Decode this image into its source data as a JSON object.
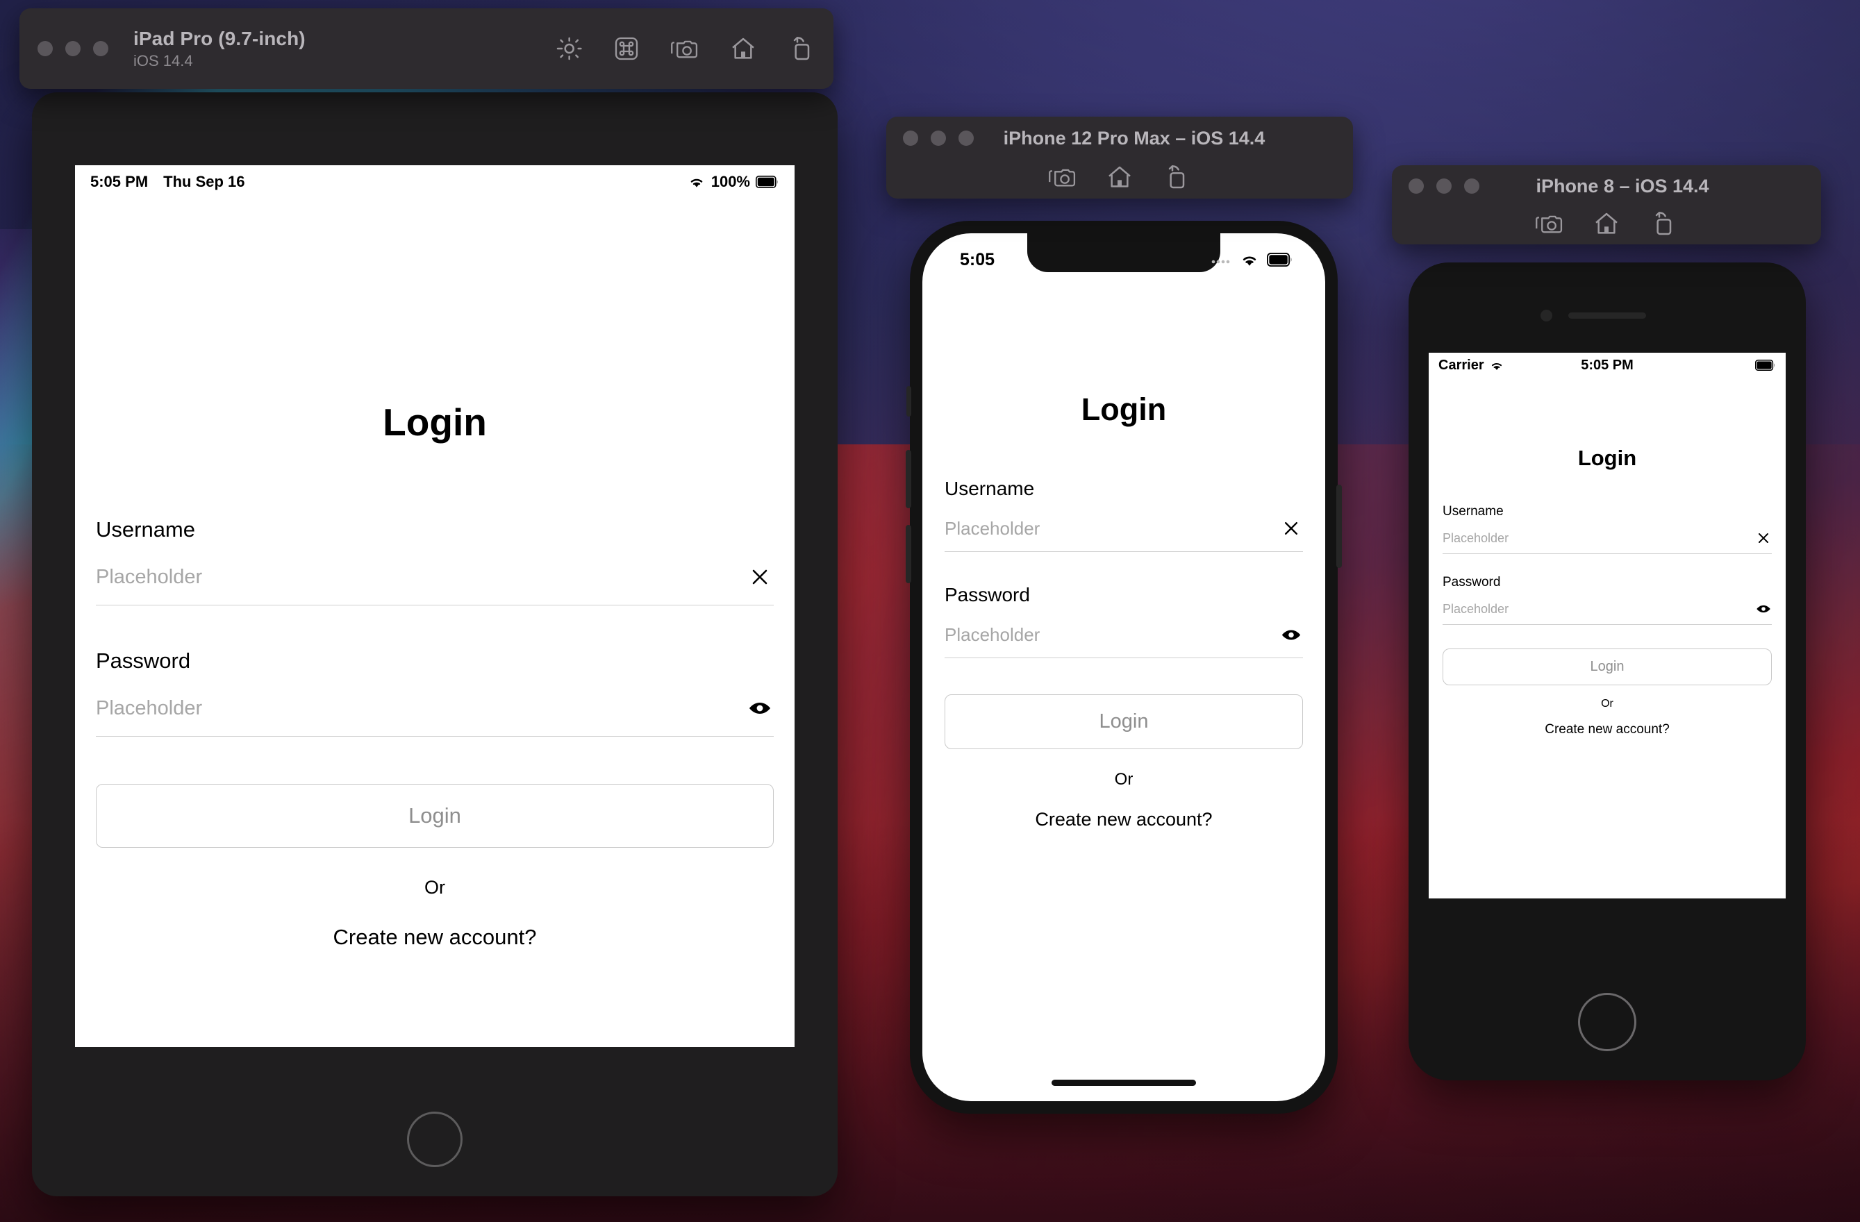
{
  "desktop": {
    "wallpaper_name": "macos-big-sur-gradient",
    "colors": {
      "indigo": "#2b2d5e",
      "wave_indigo": "#4c4892",
      "purple": "#6a42a8",
      "teal": "#40a6c4",
      "red": "#be2a2c",
      "dark_red": "#4e101c",
      "window_chrome": "#2e2b2f",
      "traffic_light": "#5a565b",
      "title_text": "#b9b6bb",
      "subtitle_text": "#8e8b90"
    }
  },
  "windows": [
    {
      "id": "ipad",
      "title": "iPad Pro (9.7-inch)",
      "subtitle": "iOS 14.4",
      "traffic_lights": [
        "close",
        "minimize",
        "zoom"
      ],
      "toolbar_icons": [
        "brightness-icon",
        "command-key-icon",
        "screenshot-camera-icon",
        "home-icon",
        "rotate-device-icon"
      ]
    },
    {
      "id": "iphone12",
      "title": "iPhone 12 Pro Max – iOS 14.4",
      "traffic_lights": [
        "close",
        "minimize",
        "zoom"
      ],
      "toolbar_icons": [
        "screenshot-camera-icon",
        "home-icon",
        "rotate-device-icon"
      ]
    },
    {
      "id": "iphone8",
      "title": "iPhone 8 – iOS 14.4",
      "traffic_lights": [
        "close",
        "minimize",
        "zoom"
      ],
      "toolbar_icons": [
        "screenshot-camera-icon",
        "home-icon",
        "rotate-device-icon"
      ]
    }
  ],
  "status_bars": {
    "ipad": {
      "time": "5:05 PM",
      "date": "Thu Sep 16",
      "wifi_icon": "wifi-icon",
      "battery_percent": "100%",
      "battery_icon": "battery-full-icon"
    },
    "iphone12": {
      "time": "5:05",
      "signal_icon": "cellular-signal-icon",
      "wifi_icon": "wifi-icon",
      "battery_icon": "battery-full-icon"
    },
    "iphone8": {
      "carrier": "Carrier",
      "wifi_icon": "wifi-icon",
      "time": "5:05 PM",
      "battery_icon": "battery-full-icon"
    }
  },
  "login_form": {
    "title": "Login",
    "username": {
      "label": "Username",
      "placeholder": "Placeholder",
      "value": "",
      "trailing_icon": "clear-x-icon"
    },
    "password": {
      "label": "Password",
      "placeholder": "Placeholder",
      "value": "",
      "trailing_icon": "eye-reveal-icon"
    },
    "submit_label": "Login",
    "divider_text": "Or",
    "create_account_label": "Create new account?",
    "colors": {
      "placeholder": "#a6a6a6",
      "underline": "#cfcfcf",
      "button_border": "#c9c9c9",
      "button_text": "#8e8e8e",
      "text": "#000000"
    }
  }
}
